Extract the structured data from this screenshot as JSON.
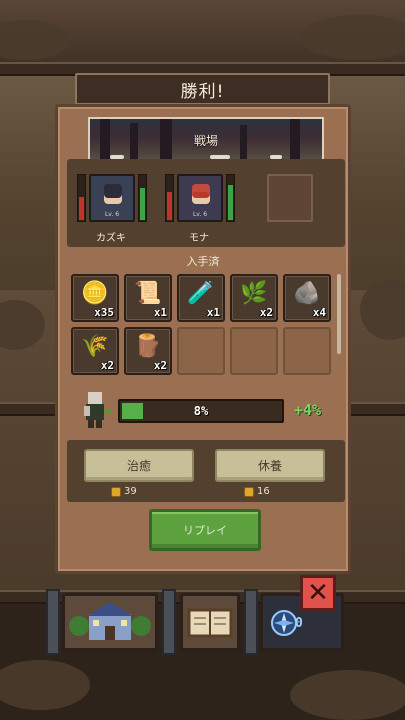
{
  "dialog": {
    "title": "勝利!",
    "banner_label": "戦場",
    "obtained_label": "入手済",
    "replay_label": "リプレイ"
  },
  "party": [
    {
      "name": "カズキ",
      "level": "Lv. 6",
      "hp": 0.55,
      "sp": 0.75,
      "face_color": "#2b2b3a",
      "hair_color": "#2c2d3b"
    },
    {
      "name": "モナ",
      "level": "Lv. 6",
      "hp": 0.65,
      "sp": 0.8,
      "face_color": "#c44a3d",
      "hair_color": "#b83a2e"
    }
  ],
  "items": [
    {
      "icon": "gold-coins-icon",
      "glyph": "🪙",
      "qty": "x35"
    },
    {
      "icon": "scroll-map-icon",
      "glyph": "📜",
      "qty": "x1"
    },
    {
      "icon": "potion-icon",
      "glyph": "🧪",
      "qty": "x1"
    },
    {
      "icon": "herb-icon",
      "glyph": "🌿",
      "qty": "x2"
    },
    {
      "icon": "ore-icon",
      "glyph": "🪨",
      "qty": "x4"
    },
    {
      "icon": "cotton-branch-icon",
      "glyph": "🌾",
      "qty": "x2"
    },
    {
      "icon": "log-icon",
      "glyph": "🪵",
      "qty": "x2"
    }
  ],
  "xp": {
    "percent_label": "8%",
    "fill": 0.08,
    "gain_label": "+4%"
  },
  "actions": [
    {
      "label": "治癒",
      "cost": "39"
    },
    {
      "label": "休養",
      "cost": "16"
    }
  ],
  "dock": {
    "gem_count": "0"
  },
  "colors": {
    "accent_green": "#5ea13f",
    "hp_red": "#c0332d",
    "sp_green": "#3ea446",
    "close_red": "#e0524b"
  }
}
